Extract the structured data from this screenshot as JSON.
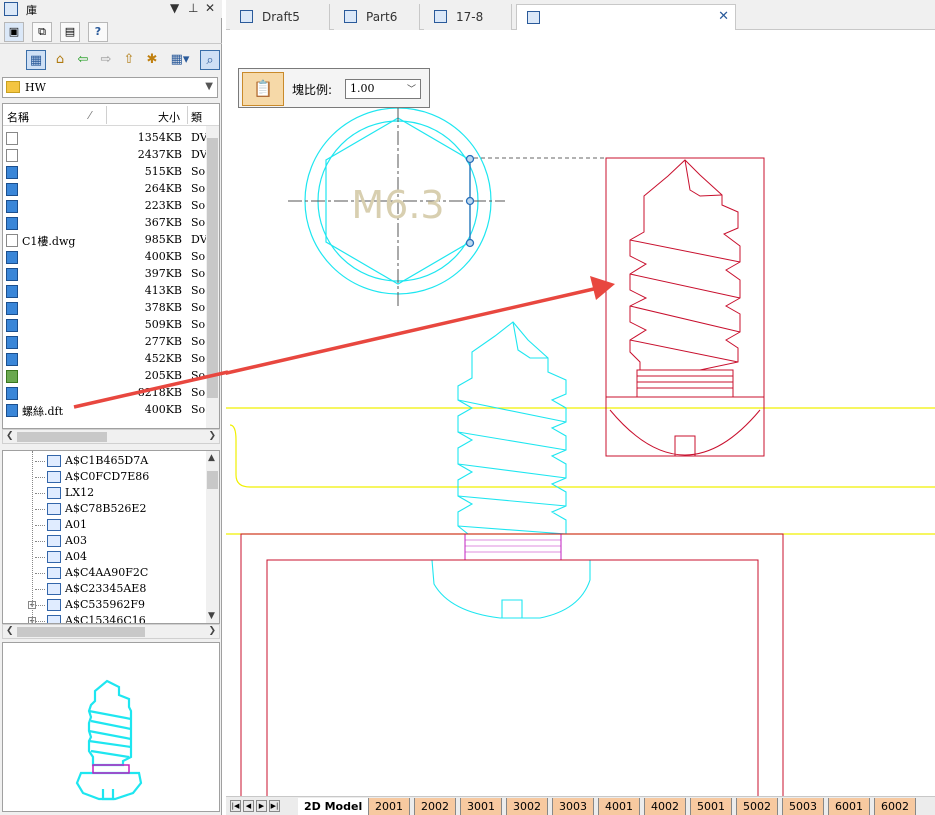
{
  "library": {
    "title": "庫",
    "controls": {
      "dropdown": "▼",
      "pin": "⊥",
      "close": "✕"
    },
    "path_value": "HW",
    "headers": {
      "name": "名稱",
      "size": "大小",
      "type": "類"
    },
    "files": [
      {
        "icon": "doc",
        "name": "",
        "size": "1354KB",
        "type": "DV"
      },
      {
        "icon": "doc",
        "name": "",
        "size": "2437KB",
        "type": "DV"
      },
      {
        "icon": "blue",
        "name": "",
        "size": "515KB",
        "type": "So"
      },
      {
        "icon": "blue",
        "name": "",
        "size": "264KB",
        "type": "So"
      },
      {
        "icon": "blue",
        "name": "",
        "size": "223KB",
        "type": "So"
      },
      {
        "icon": "blue",
        "name": "",
        "size": "367KB",
        "type": "So"
      },
      {
        "icon": "doc",
        "name": "C1樓.dwg",
        "size": "985KB",
        "type": "DV"
      },
      {
        "icon": "blue",
        "name": "",
        "size": "400KB",
        "type": "So"
      },
      {
        "icon": "blue",
        "name": "",
        "size": "397KB",
        "type": "So"
      },
      {
        "icon": "blue",
        "name": "",
        "size": "413KB",
        "type": "So"
      },
      {
        "icon": "blue",
        "name": "",
        "size": "378KB",
        "type": "So"
      },
      {
        "icon": "blue",
        "name": "",
        "size": "509KB",
        "type": "So"
      },
      {
        "icon": "blue",
        "name": "",
        "size": "277KB",
        "type": "So"
      },
      {
        "icon": "blue",
        "name": "",
        "size": "452KB",
        "type": "So"
      },
      {
        "icon": "img",
        "name": "",
        "size": "205KB",
        "type": "So"
      },
      {
        "icon": "blue",
        "name": "",
        "size": "8218KB",
        "type": "So"
      },
      {
        "icon": "blue",
        "name": "螺絲.dft",
        "size": "400KB",
        "type": "So"
      }
    ],
    "tree": [
      {
        "label": "A$C1B465D7A",
        "expandable": false
      },
      {
        "label": "A$C0FCD7E86",
        "expandable": false
      },
      {
        "label": "LX12",
        "expandable": false
      },
      {
        "label": "A$C78B526E2",
        "expandable": false
      },
      {
        "label": "A01",
        "expandable": false
      },
      {
        "label": "A03",
        "expandable": false
      },
      {
        "label": "A04",
        "expandable": false
      },
      {
        "label": "A$C4AA90F2C",
        "expandable": false
      },
      {
        "label": "A$C23345AE8",
        "expandable": false
      },
      {
        "label": "A$C535962F9",
        "expandable": true
      },
      {
        "label": "A$C15346C16",
        "expandable": true
      }
    ]
  },
  "doc_tabs": [
    {
      "label": "Draft5",
      "active": false
    },
    {
      "label": "Part6",
      "active": false
    },
    {
      "label": "17-8",
      "active": false
    },
    {
      "label": "",
      "active": true
    }
  ],
  "scale": {
    "label": "塊比例:",
    "value": "1.00"
  },
  "drawing": {
    "callout": "M6.3"
  },
  "sheet_tabs": [
    "2D Model",
    "2001",
    "2002",
    "3001",
    "3002",
    "3003",
    "4001",
    "4002",
    "5001",
    "5002",
    "5003",
    "6001",
    "6002"
  ],
  "colors": {
    "cyan": "#1ee6f0",
    "red": "#c8102e",
    "yellow": "#f0f000",
    "arrow": "#e8473f",
    "magenta": "#c020c0"
  }
}
